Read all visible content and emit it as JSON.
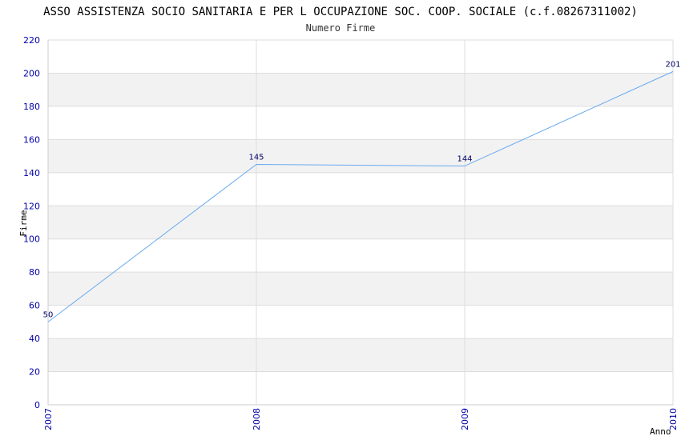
{
  "chart_data": {
    "type": "line",
    "title": "ASSO ASSISTENZA SOCIO SANITARIA E PER L OCCUPAZIONE SOC. COOP. SOCIALE (c.f.08267311002)",
    "subtitle": "Numero Firme",
    "xlabel": "Anno",
    "ylabel": "Firme",
    "categories": [
      "2007",
      "2008",
      "2009",
      "2010"
    ],
    "series": [
      {
        "values": [
          50,
          145,
          144,
          201
        ]
      }
    ],
    "data_labels": [
      "50",
      "145",
      "144",
      "201"
    ],
    "ylim": [
      0,
      220
    ],
    "yticks": [
      0,
      20,
      40,
      60,
      80,
      100,
      120,
      140,
      160,
      180,
      200,
      220
    ],
    "grid": true,
    "colors": {
      "line": "#6aaaf0",
      "band": "#f2f2f2",
      "grid": "#dddddd",
      "tick_text": "#0000aa",
      "label_text": "#000066"
    }
  }
}
